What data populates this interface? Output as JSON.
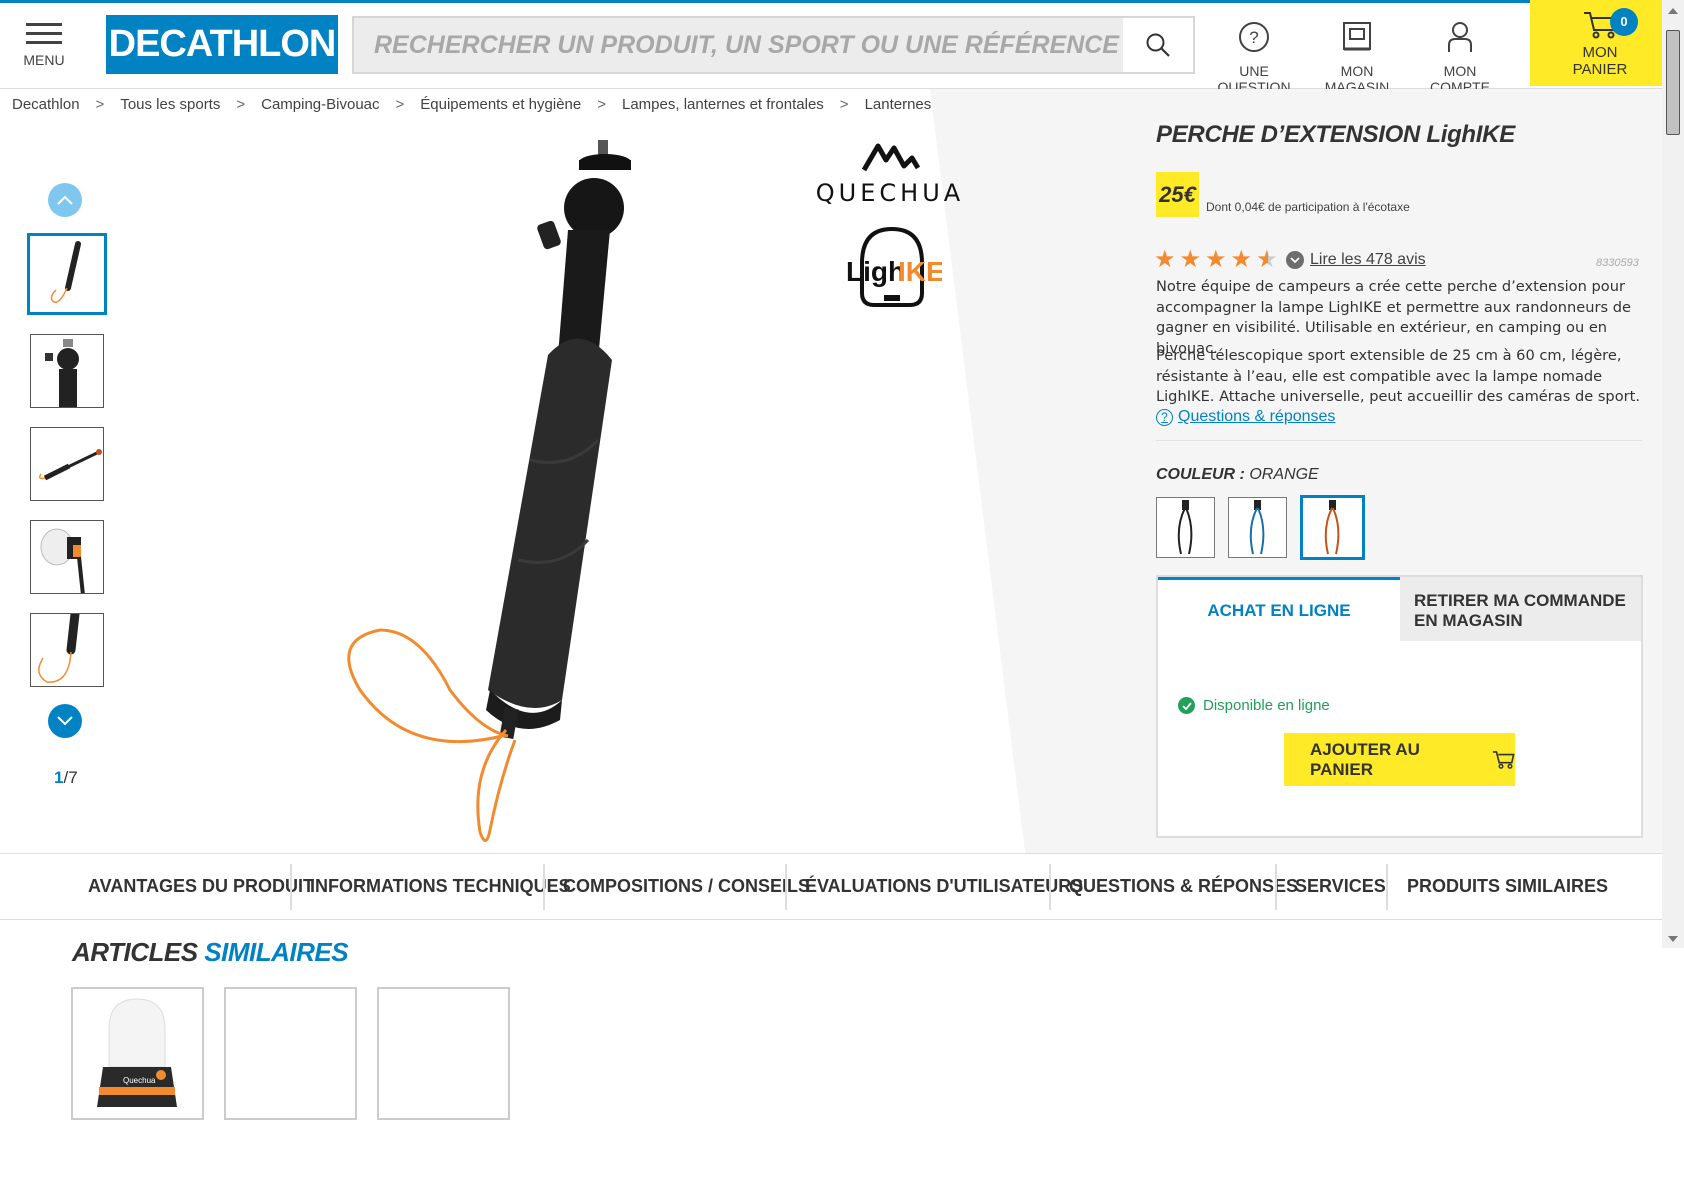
{
  "header": {
    "menu_label": "MENU",
    "logo_text": "DECATHLON",
    "search_placeholder": "RECHERCHER UN PRODUIT, UN SPORT OU UNE RÉFÉRENCE",
    "question_label": "UNE QUESTION",
    "question_sub": "?",
    "store_label": "MON MAGASIN",
    "account_label": "MON COMPTE",
    "cart_label_1": "MON",
    "cart_label_2": "PANIER",
    "cart_count": "0"
  },
  "breadcrumb": [
    "Decathlon",
    "Tous les sports",
    "Camping-Bivouac",
    "Équipements et hygiène",
    "Lampes, lanternes et frontales",
    "Lanternes"
  ],
  "breadcrumb_sep": ">",
  "gallery": {
    "page_current": "1",
    "page_total": "/7",
    "brand_name": "QUECHUA",
    "brand2_a": "Ligh",
    "brand2_b": "IKE"
  },
  "product": {
    "title": "PERCHE D’EXTENSION LighIKE",
    "price": "25€",
    "eco_text": "Dont 0,04€ de participation à l'écotaxe",
    "rating": 4.5,
    "reviews_link": "Lire les 478 avis",
    "reference": "8330593",
    "desc1": "Notre équipe de campeurs a crée cette perche d’extension pour accompagner la lampe LighIKE et permettre aux randonneurs de gagner en visibilité. Utilisable en extérieur, en camping ou en bivouac.",
    "desc2": "Perche télescopique sport extensible de 25 cm à 60 cm, légère, résistante à l’eau, elle est compatible avec la lampe nomade LighIKE. Attache universelle, peut accueillir des caméras de sport.",
    "qa_link": "Questions & réponses",
    "color_label": "COULEUR :",
    "color_value": " ORANGE",
    "swatches": [
      "#222222",
      "#1a6fa8",
      "#c4531c"
    ]
  },
  "buybox": {
    "tab_online": "ACHAT EN LIGNE",
    "tab_store": "RETIRER MA COMMANDE EN MAGASIN",
    "availability": "Disponible en ligne",
    "add_button": "AJOUTER AU PANIER"
  },
  "nav_tabs": [
    "AVANTAGES DU PRODUIT",
    "INFORMATIONS TECHNIQUES",
    "COMPOSITIONS / CONSEILS",
    "ÉVALUATIONS D'UTILISATEURS",
    "QUESTIONS & RÉPONSES",
    "SERVICES",
    "PRODUITS SIMILAIRES"
  ],
  "similar": {
    "title_a": "ARTICLES ",
    "title_b": "SIMILAIRES",
    "card_brand": "Quechua"
  },
  "colors": {
    "brand_blue": "#0082c3",
    "yellow": "#ffea28",
    "orange": "#f28b30",
    "green": "#23a15c"
  }
}
